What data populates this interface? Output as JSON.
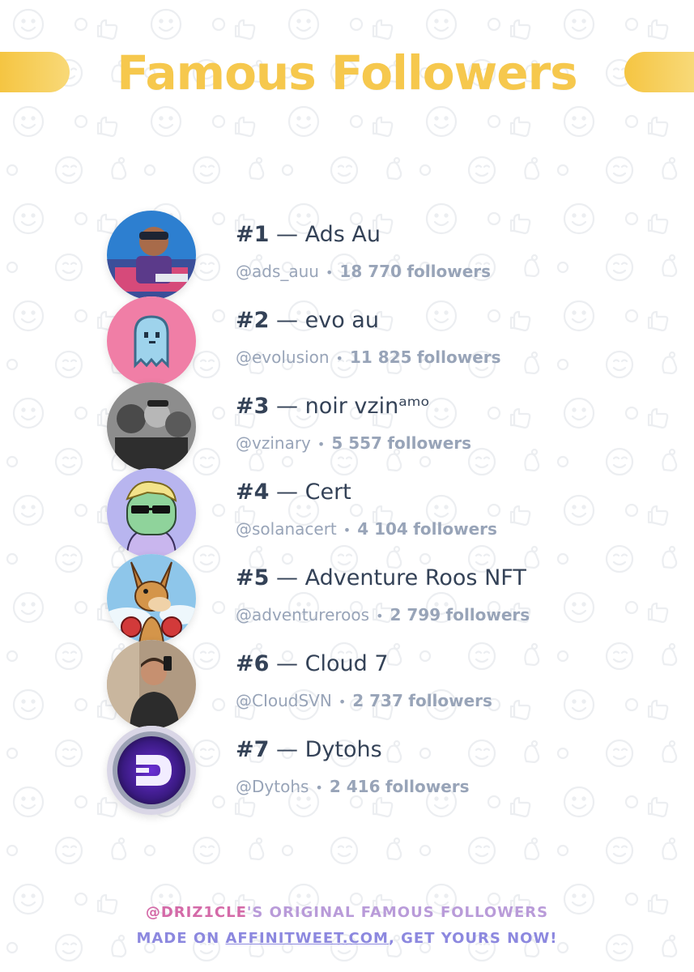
{
  "header": {
    "title": "Famous Followers",
    "accent_color": "#f6c84d"
  },
  "followers": [
    {
      "rank_label": "#1",
      "separator": "—",
      "name": "Ads Au",
      "handle": "@ads_auu",
      "count": "18 770",
      "followers_label": "followers",
      "avatar_icon": "avatar-fortnite-character"
    },
    {
      "rank_label": "#2",
      "separator": "—",
      "name": "evo au",
      "handle": "@evolusion",
      "count": "11 825",
      "followers_label": "followers",
      "avatar_icon": "avatar-pixel-ghost"
    },
    {
      "rank_label": "#3",
      "separator": "—",
      "name": "noir vzinᵃᵐᵒ",
      "handle": "@vzinary",
      "count": "5 557",
      "followers_label": "followers",
      "avatar_icon": "avatar-group-photo"
    },
    {
      "rank_label": "#4",
      "separator": "—",
      "name": "Cert",
      "handle": "@solanacert",
      "count": "4 104",
      "followers_label": "followers",
      "avatar_icon": "avatar-cartoon-sunglasses"
    },
    {
      "rank_label": "#5",
      "separator": "—",
      "name": "Adventure Roos NFT",
      "handle": "@adventureroos",
      "count": "2 799",
      "followers_label": "followers",
      "avatar_icon": "avatar-kangaroo-boxer"
    },
    {
      "rank_label": "#6",
      "separator": "—",
      "name": "Cloud 7",
      "handle": "@CIoudSVN",
      "count": "2 737",
      "followers_label": "followers",
      "avatar_icon": "avatar-mirror-selfie"
    },
    {
      "rank_label": "#7",
      "separator": "—",
      "name": "Dytohs",
      "handle": "@Dytohs",
      "count": "2 416",
      "followers_label": "followers",
      "avatar_icon": "avatar-purple-d-logo"
    }
  ],
  "footer": {
    "user": "@DRIZ1CLE",
    "line1_rest": "'S ORIGINAL FAMOUS FOLLOWERS",
    "line2_prefix": "MADE ON ",
    "link": "AFFINITWEET.COM",
    "line2_suffix": ", GET YOURS NOW!"
  },
  "colors": {
    "text_dark": "#344257",
    "text_muted": "#98a4b8",
    "footer_pink": "#d46aa8",
    "footer_purple": "#8c88df"
  }
}
